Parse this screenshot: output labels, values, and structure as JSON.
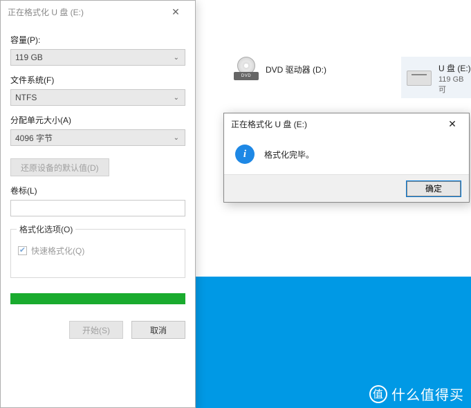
{
  "explorer": {
    "dvd": {
      "label": "DVD 驱动器 (D:)",
      "tray_text": "DVD"
    },
    "usb": {
      "label": "U 盘 (E:)",
      "sub": "119 GB 可"
    }
  },
  "format_dialog": {
    "title": "正在格式化 U 盘 (E:)",
    "capacity_label": "容量(P):",
    "capacity_value": "119 GB",
    "filesystem_label": "文件系统(F)",
    "filesystem_value": "NTFS",
    "alloc_label": "分配单元大小(A)",
    "alloc_value": "4096 字节",
    "restore_defaults": "还原设备的默认值(D)",
    "volume_label": "卷标(L)",
    "volume_value": "",
    "options_group": "格式化选项(O)",
    "quick_format": "快速格式化(Q)",
    "quick_format_checked": true,
    "progress_percent": 100,
    "start_btn": "开始(S)",
    "cancel_btn": "取消"
  },
  "msgbox": {
    "title": "正在格式化 U 盘 (E:)",
    "message": "格式化完毕。",
    "ok": "确定"
  },
  "watermark": {
    "badge": "值",
    "text": "什么值得买"
  }
}
